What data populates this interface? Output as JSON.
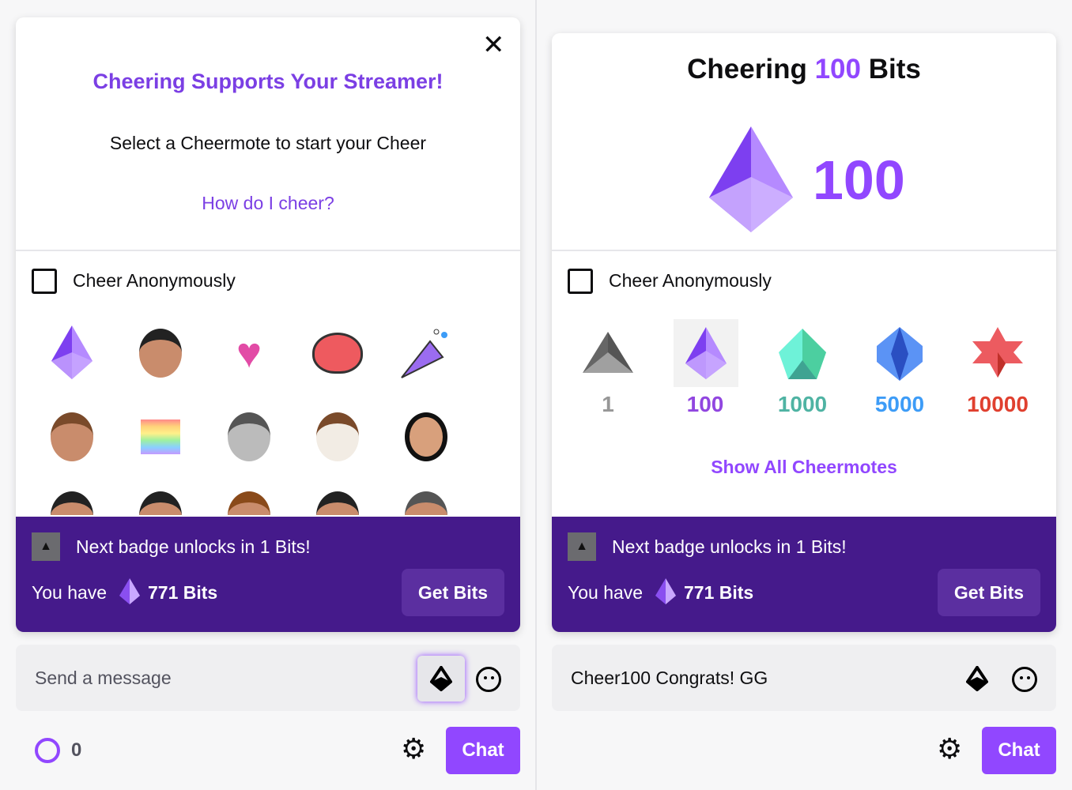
{
  "left": {
    "title": "Cheering Supports Your Streamer!",
    "subtitle": "Select a Cheermote to start your Cheer",
    "help_link": "How do I cheer?",
    "anonymous_label": "Cheer Anonymously",
    "emotes": [
      "cheer-gem",
      "streamer-face",
      "unicorn-heart",
      "heart",
      "party-popper",
      "bearded-face",
      "pride-flag",
      "gray-face",
      "dog",
      "woman-face",
      "face",
      "face",
      "face",
      "face",
      "face"
    ],
    "banner": {
      "badge_text": "Next badge unlocks in 1 Bits!",
      "you_have": "You have",
      "bits": "771 Bits",
      "get_bits": "Get Bits"
    },
    "input": {
      "placeholder": "Send a message"
    },
    "points": "0",
    "chat_button": "Chat"
  },
  "right": {
    "title_pre": "Cheering ",
    "title_amount": "100",
    "title_post": " Bits",
    "big_amount": "100",
    "anonymous_label": "Cheer Anonymously",
    "tiers": [
      {
        "label": "1",
        "color": "#979797"
      },
      {
        "label": "100",
        "color": "#9146e0",
        "selected": true
      },
      {
        "label": "1000",
        "color": "#4fb3a3"
      },
      {
        "label": "5000",
        "color": "#3d9cf7"
      },
      {
        "label": "10000",
        "color": "#e0402f"
      }
    ],
    "show_all": "Show All Cheermotes",
    "banner": {
      "badge_text": "Next badge unlocks in 1 Bits!",
      "you_have": "You have",
      "bits": "771 Bits",
      "get_bits": "Get Bits"
    },
    "input": {
      "value": "Cheer100 Congrats! GG"
    },
    "chat_button": "Chat"
  },
  "colors": {
    "accent": "#9147ff",
    "banner": "#451a8b",
    "title_purple": "#7b3fe4"
  }
}
